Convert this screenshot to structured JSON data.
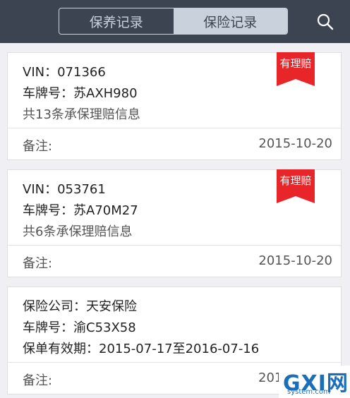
{
  "header": {
    "tabs": [
      {
        "label": "保养记录",
        "active": false
      },
      {
        "label": "保险记录",
        "active": true
      }
    ],
    "search_icon": "search-icon"
  },
  "colors": {
    "header_bg": "#3d4451",
    "tab_active_bg": "#c9d2dc",
    "ribbon_red": "#e8262a",
    "page_bg": "#efeff4"
  },
  "records": [
    {
      "line1": "VIN：071366",
      "line2": "车牌号：苏AXH980",
      "line3": "共13条承保理赔信息",
      "badge": "有理赔",
      "note_label": "备注:",
      "date": "2015-10-20"
    },
    {
      "line1": "VIN：053761",
      "line2": "车牌号：苏A70M27",
      "line3": "共6条承保理赔信息",
      "badge": "有理赔",
      "note_label": "备注:",
      "date": "2015-10-20"
    },
    {
      "line1": "保险公司：天安保险",
      "line2": "车牌号：渝C53X58",
      "line3": "保单有效期：2015-07-17至2016-07-16",
      "note_label": "备注:",
      "date": "201"
    }
  ],
  "watermark": {
    "main": "GXI网",
    "sub": "system.com"
  }
}
